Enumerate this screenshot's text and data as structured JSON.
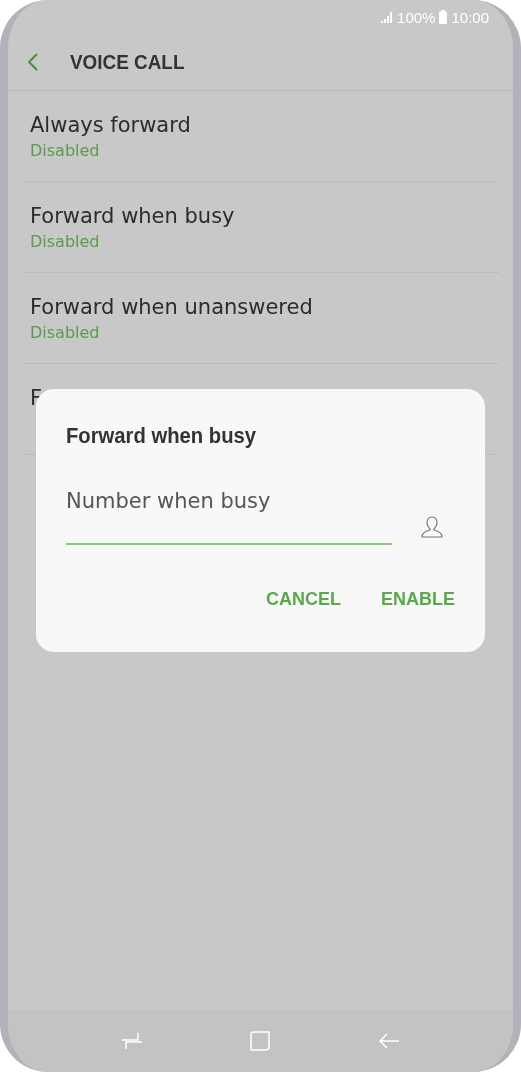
{
  "status_bar": {
    "battery": "100%",
    "time": "10:00"
  },
  "header": {
    "title": "VOICE CALL"
  },
  "items": [
    {
      "title": "Always forward",
      "status": "Disabled"
    },
    {
      "title": "Forward when busy",
      "status": "Disabled"
    },
    {
      "title": "Forward when unanswered",
      "status": "Disabled"
    },
    {
      "title": "F"
    }
  ],
  "dialog": {
    "title": "Forward when busy",
    "field": {
      "placeholder": "Number when busy"
    },
    "buttons": [
      "CANCEL",
      "ENABLE"
    ]
  }
}
